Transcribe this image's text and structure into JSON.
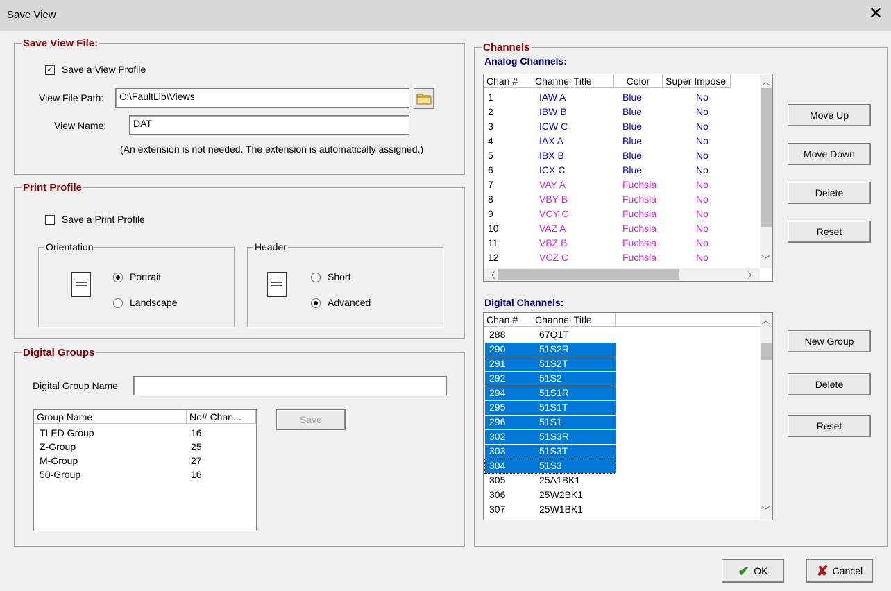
{
  "window": {
    "title": "Save View",
    "close": "✕"
  },
  "save_view_file": {
    "legend": "Save View File:",
    "save_profile_label": "Save a View Profile",
    "path_label": "View File Path:",
    "path_value": "C:\\FaultLib\\Views",
    "name_label": "View Name:",
    "name_value": "DAT",
    "note": "(An extension is not needed. The extension is automatically assigned.)"
  },
  "print_profile": {
    "legend": "Print Profile",
    "save_label": "Save a Print Profile",
    "orientation": {
      "legend": "Orientation",
      "portrait": "Portrait",
      "landscape": "Landscape"
    },
    "header": {
      "legend": "Header",
      "short": "Short",
      "advanced": "Advanced"
    }
  },
  "digital_groups": {
    "legend": "Digital Groups",
    "name_label": "Digital Group Name",
    "name_value": "",
    "columns": [
      "Group Name",
      "No# Chan..."
    ],
    "rows": [
      [
        "TLED Group",
        "16"
      ],
      [
        "Z-Group",
        "25"
      ],
      [
        "M-Group",
        "27"
      ],
      [
        "50-Group",
        "16"
      ]
    ],
    "save_button": "Save"
  },
  "channels": {
    "legend": "Channels",
    "analog_title": "Analog Channels:",
    "analog_columns": [
      "Chan #",
      "Channel Title",
      "Color",
      "Super Impose"
    ],
    "analog_rows": [
      [
        "1",
        "IAW A",
        "Blue",
        "No"
      ],
      [
        "2",
        "IBW B",
        "Blue",
        "No"
      ],
      [
        "3",
        "ICW C",
        "Blue",
        "No"
      ],
      [
        "4",
        "IAX A",
        "Blue",
        "No"
      ],
      [
        "5",
        "IBX B",
        "Blue",
        "No"
      ],
      [
        "6",
        "ICX C",
        "Blue",
        "No"
      ],
      [
        "7",
        "VAY A",
        "Fuchsia",
        "No"
      ],
      [
        "8",
        "VBY B",
        "Fuchsia",
        "No"
      ],
      [
        "9",
        "VCY C",
        "Fuchsia",
        "No"
      ],
      [
        "10",
        "VAZ A",
        "Fuchsia",
        "No"
      ],
      [
        "11",
        "VBZ B",
        "Fuchsia",
        "No"
      ],
      [
        "12",
        "VCZ C",
        "Fuchsia",
        "No"
      ]
    ],
    "digital_title": "Digital Channels:",
    "digital_columns": [
      "Chan #",
      "Channel Title"
    ],
    "digital_rows": [
      [
        "288",
        "67Q1T"
      ],
      [
        "290",
        "51S2R"
      ],
      [
        "291",
        "51S2T"
      ],
      [
        "292",
        "51S2"
      ],
      [
        "294",
        "51S1R"
      ],
      [
        "295",
        "51S1T"
      ],
      [
        "296",
        "51S1"
      ],
      [
        "302",
        "51S3R"
      ],
      [
        "303",
        "51S3T"
      ],
      [
        "304",
        "51S3"
      ],
      [
        "305",
        "25A1BK1"
      ],
      [
        "306",
        "25W2BK1"
      ],
      [
        "307",
        "25W1BK1"
      ]
    ],
    "move_up": "Move Up",
    "move_down": "Move Down",
    "delete": "Delete",
    "reset": "Reset",
    "new_group": "New Group",
    "delete2": "Delete",
    "reset2": "Reset"
  },
  "footer": {
    "ok": "OK",
    "cancel": "Cancel"
  },
  "colors": {
    "legend_red": "#8b0000",
    "section_blue": "#000080",
    "blue_text": "#0000cc",
    "fuchsia_text": "#e020e0",
    "selection": "#0078d7"
  }
}
